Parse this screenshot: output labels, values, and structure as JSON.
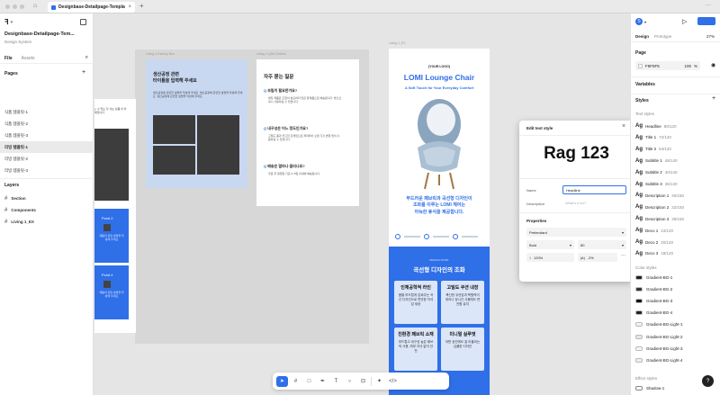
{
  "browser": {
    "tab_title": "Designbase-Detailpage-Templat",
    "new_tab": "+"
  },
  "file": {
    "name": "Designbase-Detailpage-Tem...",
    "subtitle": "Design System",
    "panel_tabs": [
      "File",
      "Assets"
    ],
    "pages_label": "Pages",
    "pages": [
      "식품 템플릿-1",
      "식품 템플릿-2",
      "식품 템플릿-3",
      "리빙 템플릿-1",
      "리빙 템플릿-2",
      "리빙 템플릿-3"
    ],
    "active_page_index": 3,
    "layers_label": "Layers",
    "layers": [
      "Section",
      "Components",
      "Living 1_EX"
    ]
  },
  "canvas": {
    "frame_labels": [
      "Living 1-Factory Box",
      "Living 1-Q&A Section",
      "Living 1_EX"
    ],
    "factory": {
      "title": "생산공정 관련\n타이틀을 입력해 주세요",
      "body": "생산공정에 관련한 설명을 작성해 주세요. 생산공정에 관련한 설명을 작성해 주세요. 생산공정에 관련한 설명을 작성해 주세요."
    },
    "qa": {
      "title": "자주 묻는 질문",
      "items": [
        {
          "q": "조립이 필요한가요?",
          "a": "해당 제품은 조립이 필요하지 않은 완제품으로 배송됩니다. 받으신 즉시 사용하실 수 있습니다."
        },
        {
          "q": "내구성은 어느 정도인가요?",
          "a": "고밀도 폼과 견고한 프레임으로 제작되어 오랜 기간 변형 없이 사용하실 수 있습니다."
        },
        {
          "q": "배송은 얼마나 걸리나요?",
          "a": "주문 후 영업일 기준 3~5일 이내에 배송됩니다."
        }
      ]
    },
    "left_partial": {
      "text": "y. 수 있는 다 사는 상품 이 차례입니다",
      "points": [
        "Point 2",
        "Point 4"
      ],
      "point_desc": "제품의 관련 설명을 작성해 주세요"
    },
    "product": {
      "logo": "[YOUR LOGO]",
      "title": "LOMI Lounge Chair",
      "subtitle": "A Soft Touch for Your Everyday Comfort",
      "desc": "부드러운 패브릭과 곡선형 디자인이\n조화를 이루는 LOMI 체어는\n아늑한 휴식을 제공합니다.",
      "banner_small": "DESIGN POINT",
      "banner_title": "곡선형 디자인의 조화",
      "cards": [
        {
          "t": "인체공학적 라인",
          "d": "몸을 부드럽게 감싸주는 곡선 디자인으로 편안한 착석감 제공"
        },
        {
          "t": "고밀도 쿠션 내장",
          "d": "푹신한 쿠션감과 복원력이 뛰어나 장시간 사용에도 편안함 유지"
        },
        {
          "t": "친환경 패브릭 소재",
          "d": "부드럽고 내구성 높은 패브릭 사용, 피부 자극 없이 안전"
        },
        {
          "t": "미니멀 실루엣",
          "d": "어떤 공간에도 잘 어울리는 심플한 디자인"
        }
      ]
    }
  },
  "edit_panel": {
    "title": "Edit text style",
    "preview": "Rag 123",
    "name_label": "Name",
    "name_value": "Headline",
    "desc_label": "Description",
    "desc_placeholder": "What's it for?",
    "props_label": "Properties",
    "font": "Pretendard",
    "weight": "Bold",
    "size": "80",
    "line_height": "120%",
    "letter_spacing": "-2%",
    "close": "×"
  },
  "right": {
    "avatar": "S",
    "tabs": [
      "Design",
      "Prototype"
    ],
    "zoom": "27%",
    "page_label": "Page",
    "page_color": "F5F5F5",
    "page_opacity": "100",
    "opacity_unit": "%",
    "variables_label": "Variables",
    "styles_label": "Styles",
    "text_styles_label": "Text styles",
    "text_styles": [
      {
        "n": "Headline",
        "s": "80/120"
      },
      {
        "n": "Title 1",
        "s": "72/120"
      },
      {
        "n": "Title 2",
        "s": "64/120"
      },
      {
        "n": "Subtitle 1",
        "s": "48/140"
      },
      {
        "n": "Subtitle 2",
        "s": "40/140"
      },
      {
        "n": "Subtitle 3",
        "s": "36/140"
      },
      {
        "n": "Description 1",
        "s": "40/150"
      },
      {
        "n": "Description 2",
        "s": "32/150"
      },
      {
        "n": "Description 3",
        "s": "28/150"
      },
      {
        "n": "Deco 1",
        "s": "24/120"
      },
      {
        "n": "Deco 2",
        "s": "20/120"
      },
      {
        "n": "Deco 3",
        "s": "18/120"
      }
    ],
    "color_styles_label": "Color styles",
    "color_styles": [
      {
        "n": "Gradient-BG-1",
        "c": "#1e1e1e"
      },
      {
        "n": "Gradient-BG-2",
        "c": "#333333"
      },
      {
        "n": "Gradient-BG-3",
        "c": "#111111"
      },
      {
        "n": "Gradient-BG-4",
        "c": "#222222"
      },
      {
        "n": "Gradient-BG-Light-1",
        "c": "#f2f2f2"
      },
      {
        "n": "Gradient-BG-Light-2",
        "c": "#e8e8e8"
      },
      {
        "n": "Gradient-BG-Light-3",
        "c": "#f5f5f5"
      },
      {
        "n": "Gradient-BG-Light-4",
        "c": "#eeeeee"
      }
    ],
    "effect_styles_label": "Effect styles",
    "effect_styles": [
      "Shadow-1"
    ]
  },
  "toolbar": {
    "icons": [
      "move-tool",
      "frame-tool",
      "shape-tool",
      "pen-tool",
      "text-tool",
      "comment-tool",
      "actions-tool",
      "dev-mode-tool"
    ]
  },
  "colors": {
    "accent": "#2f6fe8",
    "canvas": "#e5e5e5"
  }
}
